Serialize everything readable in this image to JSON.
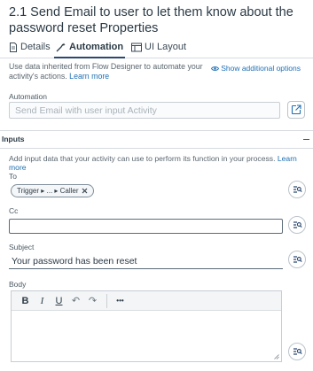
{
  "header": {
    "title": "2.1 Send Email to user to let them know about the password reset Properties"
  },
  "tabs": [
    {
      "label": "Details",
      "icon": "document-icon"
    },
    {
      "label": "Automation",
      "icon": "automation-icon",
      "active": true
    },
    {
      "label": "UI Layout",
      "icon": "layout-icon"
    }
  ],
  "automation_info": {
    "text": "Use data inherited from Flow Designer to automate your activity's actions. ",
    "link": "Learn more",
    "show_options": "Show additional options"
  },
  "automation": {
    "label": "Automation",
    "placeholder": "Send Email with user input Activity"
  },
  "inputs": {
    "section_title": "Inputs",
    "description": "Add input data that your activity can use to perform its function in your process. ",
    "link": "Learn more",
    "to": {
      "label": "To",
      "pill": "Trigger ▸ ... ▸ Caller"
    },
    "cc": {
      "label": "Cc",
      "value": ""
    },
    "subject": {
      "label": "Subject",
      "value": "Your password has been reset"
    },
    "body": {
      "label": "Body",
      "toolbar": [
        "B",
        "I",
        "U",
        "↶",
        "↷",
        "•••"
      ]
    }
  },
  "colors": {
    "accent": "#1f6fb2",
    "tab_underline": "#2b4870",
    "text": "#2b3a45"
  }
}
